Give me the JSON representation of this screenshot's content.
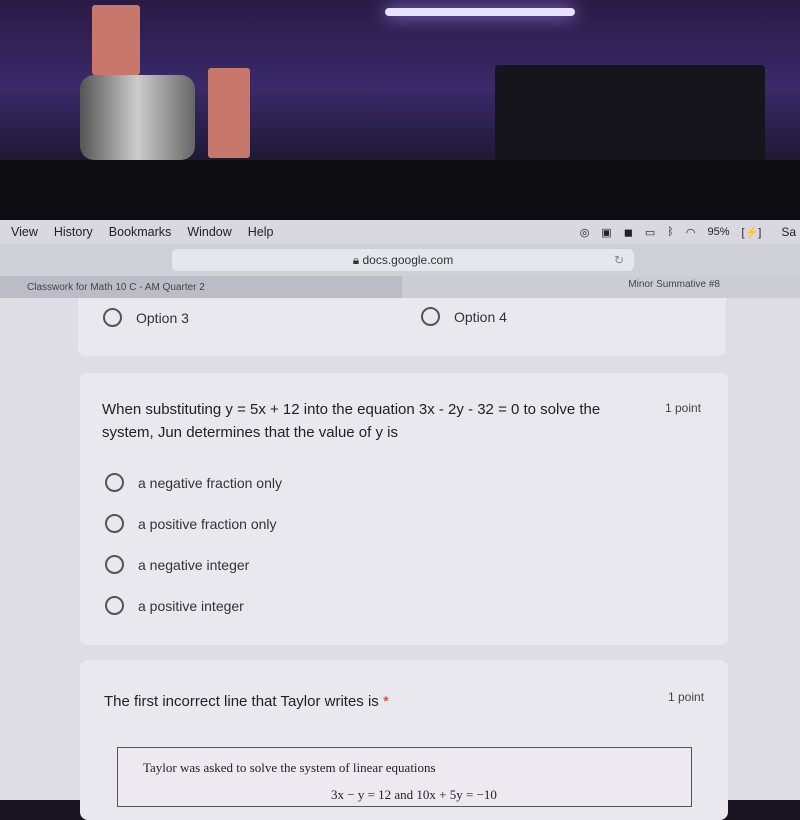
{
  "menubar": {
    "items": [
      "View",
      "History",
      "Bookmarks",
      "Window",
      "Help"
    ],
    "battery": "95%",
    "clock": "Sa"
  },
  "browser": {
    "url": "docs.google.com",
    "tabs": [
      "Classwork for Math 10 C - AM Quarter 2",
      "Minor Summative #8"
    ]
  },
  "prev_question": {
    "options": [
      "Option 3",
      "Option 4"
    ]
  },
  "question1": {
    "text": "When substituting y = 5x + 12 into the equation 3x - 2y - 32 = 0 to solve the system, Jun determines that the value of y is",
    "points": "1 point",
    "options": [
      "a negative fraction only",
      "a positive fraction only",
      "a negative integer",
      "a positive integer"
    ]
  },
  "question2": {
    "text": "The first incorrect line that Taylor writes is",
    "required": "*",
    "points": "1 point",
    "image_text": {
      "line1": "Taylor was asked to solve the system of linear equations",
      "line2": "3x − y = 12 and 10x + 5y = −10"
    }
  }
}
